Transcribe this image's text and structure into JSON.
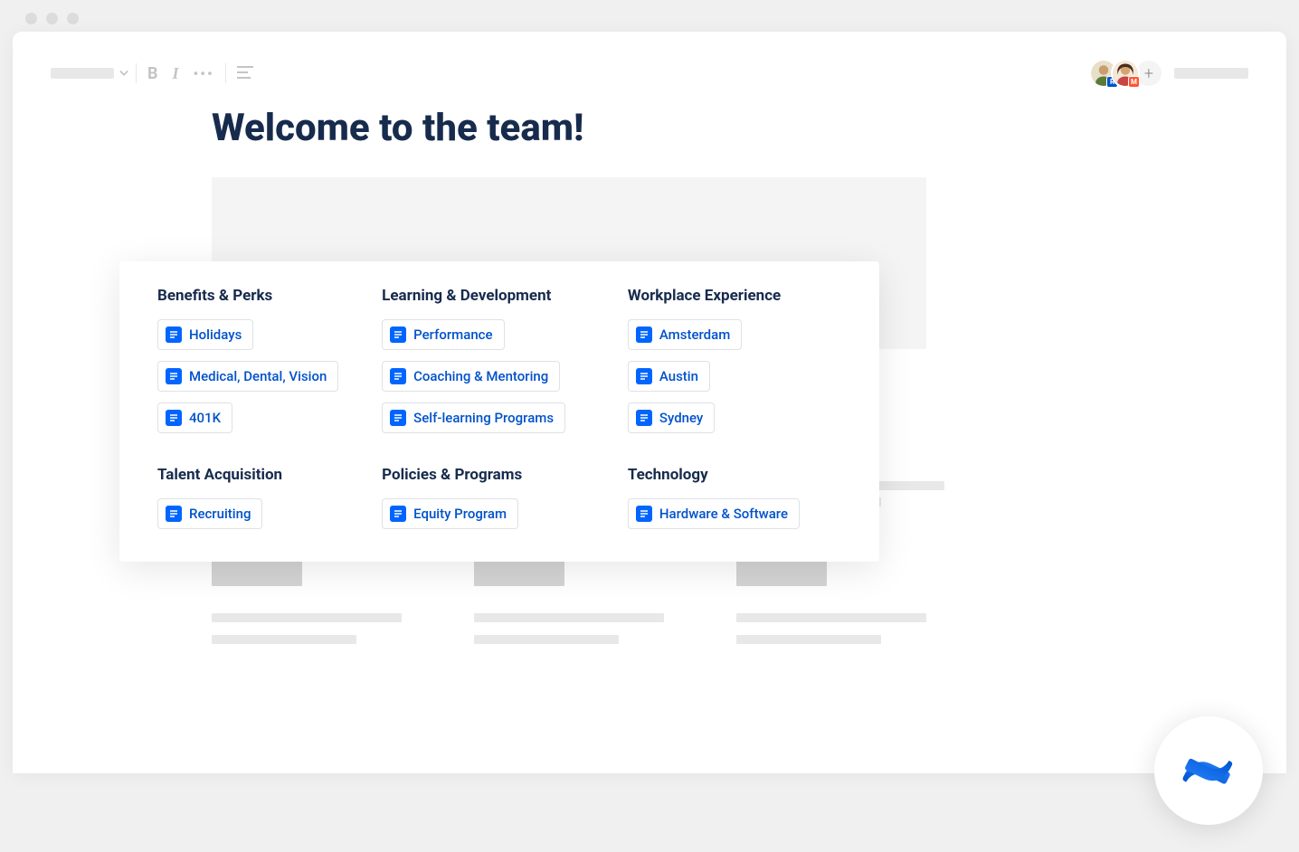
{
  "page": {
    "title": "Welcome to the team!"
  },
  "avatars": [
    {
      "badge": "R"
    },
    {
      "badge": "M"
    }
  ],
  "card": {
    "sections": [
      {
        "heading": "Benefits & Perks",
        "items": [
          "Holidays",
          "Medical, Dental, Vision",
          "401K"
        ]
      },
      {
        "heading": "Learning & Development",
        "items": [
          "Performance",
          "Coaching & Mentoring",
          "Self-learning Programs"
        ]
      },
      {
        "heading": "Workplace Experience",
        "items": [
          "Amsterdam",
          "Austin",
          "Sydney"
        ]
      },
      {
        "heading": "Talent Acquisition",
        "items": [
          "Recruiting"
        ]
      },
      {
        "heading": "Policies & Programs",
        "items": [
          "Equity Program"
        ]
      },
      {
        "heading": "Technology",
        "items": [
          "Hardware & Software"
        ]
      }
    ]
  }
}
